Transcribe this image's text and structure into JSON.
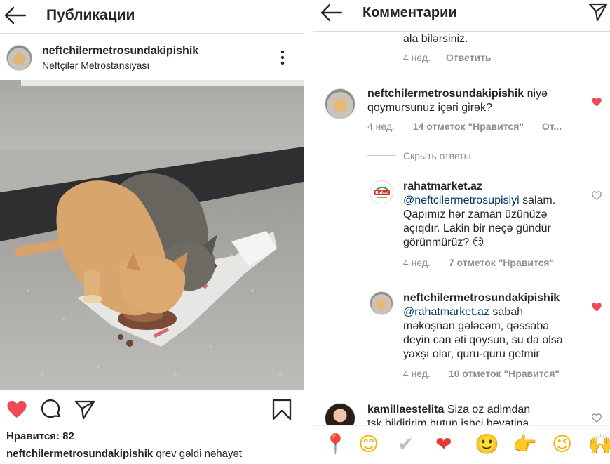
{
  "left": {
    "header": {
      "title": "Публикации"
    },
    "post": {
      "username": "neftchilermetrosundakipishik",
      "location": "Neftçilər Metrostansiyası",
      "likes": "Нравится: 82",
      "caption_user": "neftchilermetrosundakipishik",
      "caption_text": "qrev gəldi nəhayət"
    },
    "icons": [
      "back-arrow-icon",
      "more-vertical-icon",
      "heart-filled-icon",
      "comment-icon",
      "share-icon",
      "bookmark-icon"
    ]
  },
  "right": {
    "header": {
      "title": "Комментарии"
    },
    "comments": [
      {
        "text_tail": "ala bilərsiniz.",
        "time": "4 нед.",
        "reply": "Ответить"
      },
      {
        "user": "neftchilermetrosundakipishik",
        "text_1": " niyə",
        "text_2": "qoymursunuz içəri girək?",
        "time": "4 нед.",
        "likes": "14 отметок \"Нравится\"",
        "reply": "От...",
        "liked": true,
        "hide_replies": "Скрыть ответы"
      },
      {
        "user": "rahatmarket.az",
        "mention": "@neftcilermetrosupisiyi",
        "line_1_rest": " salam.",
        "line_2": "Qapımız hər zaman üzünüzə",
        "line_3": "açıqdır. Lakin bir neçə gündür",
        "line_4": "görünmürüz? 😏",
        "time": "4 нед.",
        "likes": "7 отметок \"Нравится\"",
        "liked": false,
        "avatar_label": "Rahat"
      },
      {
        "user": "neftchilermetrosundakipishik",
        "mention": "@rahatmarket.az",
        "line_1_rest": " sabah",
        "line_2": "məkoşnan gələcəm, qəssaba",
        "line_3": "deyin can əti qoysun, su da olsa",
        "line_4": "yaxşı olar, quru-quru getmir",
        "time": "4 нед.",
        "likes": "10 отметок \"Нравится\"",
        "liked": true
      },
      {
        "user": "kamillaestelita",
        "text_1": " Siza oz adimdan",
        "text_2": "tsk bildiririm butun ishci heyatina",
        "liked": false
      }
    ],
    "emoji_bar": [
      "📍",
      "😊",
      "✔",
      "❤",
      "🙂",
      "👉",
      "😉",
      "🙌"
    ]
  },
  "colors": {
    "like_red": "#ed4956",
    "meta_gray": "#8e8e8e",
    "mention_blue": "#003569",
    "text": "#262626"
  }
}
